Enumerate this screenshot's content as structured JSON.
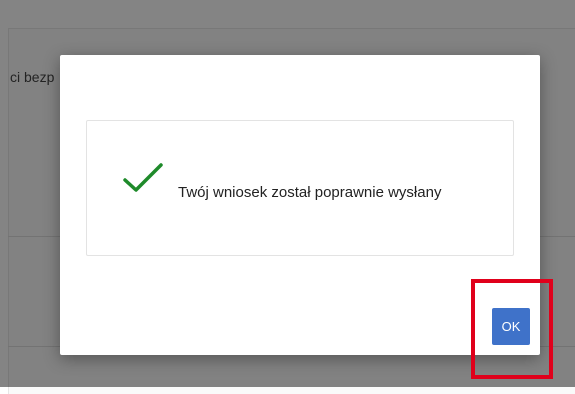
{
  "background": {
    "partial_text": "ci bezp"
  },
  "dialog": {
    "message": "Twój wniosek został poprawnie wysłany",
    "status_icon": "checkmark-icon",
    "ok_label": "OK"
  },
  "colors": {
    "check": "#1e8a2a",
    "ok_button": "#3f72c9",
    "highlight": "#e0001b"
  }
}
